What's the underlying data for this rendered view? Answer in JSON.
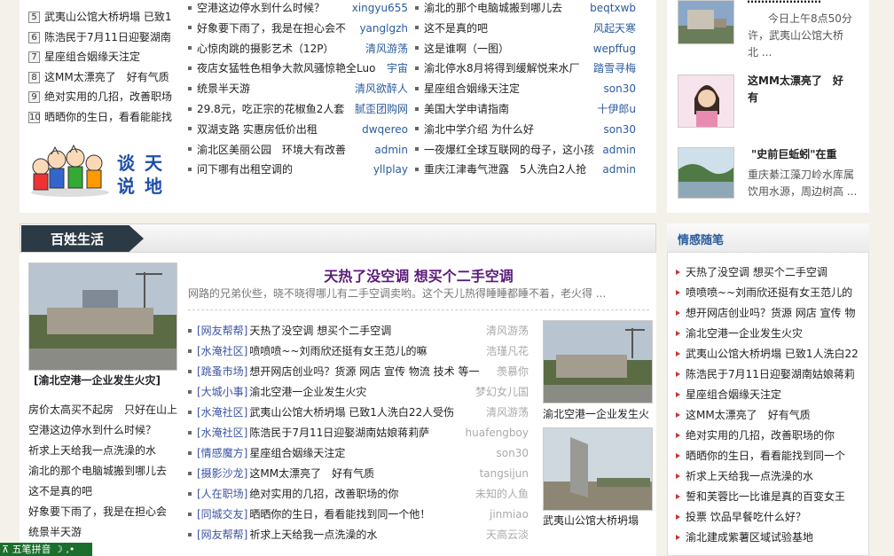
{
  "top_rank": [
    {
      "n": "5",
      "t": "武夷山公馆大桥坍塌 已致1"
    },
    {
      "n": "6",
      "t": "陈浩民于7月11日迎娶湖南"
    },
    {
      "n": "7",
      "t": "星座组合姻缘天注定"
    },
    {
      "n": "8",
      "t": "这MM太漂亮了　好有气质"
    },
    {
      "n": "9",
      "t": "绝对实用的几招，改善职场"
    },
    {
      "n": "10",
      "t": "晒晒你的生日，看看能能找"
    }
  ],
  "tantian": {
    "line1": "谈 天",
    "line2": "说 地"
  },
  "mid_col1": [
    {
      "t": "空港这边停水到什么时候？",
      "u": "xingyu655"
    },
    {
      "t": "好象要下雨了，我是在担心会不",
      "u": "yanglgzh"
    },
    {
      "t": "心惊肉跳的摄影艺术（12P）",
      "u": "清风游荡"
    },
    {
      "t": "夜店女猛牲色相争大款风骚惊艳全Luo",
      "u": "宇宙"
    },
    {
      "t": "统景半天游",
      "u": "清风欲醉人"
    },
    {
      "t": "29.8元，吃正宗的花椒鱼2人套",
      "u": "腻歪团购网"
    },
    {
      "t": "双湖支路 实惠房低价出租",
      "u": "dwqereo"
    },
    {
      "t": "渝北区美丽公园　环境大有改善",
      "u": "admin"
    },
    {
      "t": "问下哪有出租空调的",
      "u": "yllplay"
    }
  ],
  "mid_col2": [
    {
      "t": "渝北的那个电脑城搬到哪儿去",
      "u": "beqtxwb"
    },
    {
      "t": "这不是真的吧",
      "u": "风起天寒"
    },
    {
      "t": "这是谁啊（一图）",
      "u": "wepffug"
    },
    {
      "t": "渝北停水8月将得到缓解悦来水厂",
      "u": "踏雪寻梅"
    },
    {
      "t": "星座组合姻缘天注定",
      "u": "son30"
    },
    {
      "t": "美国大学申请指南",
      "u": "十伊郎u"
    },
    {
      "t": "渝北中学介绍 为什么好",
      "u": "son30"
    },
    {
      "t": "一夜爆红全球互联网的母子，这小孩",
      "u": "admin"
    },
    {
      "t": "重庆江津毒气泄露　5人洗白2人抢",
      "u": "admin"
    }
  ],
  "right_top": {
    "item1_partial": "…………………",
    "item1_desc1": "今日上午8点50分",
    "item1_desc2": "许，武夷山公馆大桥",
    "item1_desc3": "北 ...",
    "item2_title": "这MM太漂亮了　好",
    "item2_title2": "有",
    "item3_title": "\"史前巨蚯蚓\"在重",
    "item3_desc1": "重庆綦江藻刀岭水库属",
    "item3_desc2": "饮用水源，周边树高 ..."
  },
  "baixing": {
    "title": "百姓生活",
    "feature_photo_caption": "[渝北空港一企业发生火灾]",
    "headline": "天热了没空调 想买个二手空调",
    "summary": "网路的兄弟伙些，晓不晓得哪儿有二手空调卖哟。这个天儿热得睡睡都睡不着，老火得 ...",
    "left_list": [
      "房价太高买不起房　只好在山上",
      "空港这边停水到什么时候？",
      "祈求上天给我一点洗澡的水",
      "渝北的那个电脑城搬到哪儿去",
      "这不是真的吧",
      "好象要下雨了，我是在担心会",
      "统景半天游"
    ],
    "list": [
      {
        "c": "[网友帮帮]",
        "t": "天热了没空调 想买个二手空调",
        "u": "清风游荡"
      },
      {
        "c": "[水淹社区]",
        "t": "喷喷喷~~刘雨欣还挺有女王范儿的嘛",
        "u": "浩瑾凡花"
      },
      {
        "c": "[跳蚤市场]",
        "t": "想开网店创业吗？货源 网店 宣传 物流 技术 等一",
        "u": "羡慕你"
      },
      {
        "c": "[大城小事]",
        "t": "渝北空港一企业发生火灾",
        "u": "梦幻女儿国"
      },
      {
        "c": "[水淹社区]",
        "t": "武夷山公馆大桥坍塌 已致1人洗白22人受伤",
        "u": "清风游荡"
      },
      {
        "c": "[水淹社区]",
        "t": "陈浩民于7月11日迎娶湖南姑娘蒋莉萨",
        "u": "huafengboy"
      },
      {
        "c": "[情感魔方]",
        "t": "星座组合姻缘天注定",
        "u": "son30"
      },
      {
        "c": "[摄影沙龙]",
        "t": "这MM太漂亮了　好有气质",
        "u": "tangsijun"
      },
      {
        "c": "[人在职场]",
        "t": "绝对实用的几招，改善职场的你",
        "u": "未知的人鱼"
      },
      {
        "c": "[同城交友]",
        "t": "晒晒你的生日，看看能找到同一个他！",
        "u": "jinmiao"
      },
      {
        "c": "[网友帮帮]",
        "t": "祈求上天给我一点洗澡的水",
        "u": "天高云淡"
      }
    ],
    "photo_caption1": "渝北空港一企业发生火",
    "photo_caption2": "武夷山公馆大桥坍塌"
  },
  "qinggan": {
    "title": "情感随笔",
    "items": [
      "天热了没空调 想买个二手空调",
      "喷喷喷~~刘雨欣还挺有女王范儿的",
      "想开网店创业吗？货源 网店 宣传 物",
      "渝北空港一企业发生火灾",
      "武夷山公馆大桥坍塌 已致1人洗白22",
      "陈浩民于7月11日迎娶湖南姑娘蒋莉",
      "星座组合姻缘天注定",
      "这MM太漂亮了　好有气质",
      "绝对实用的几招，改善职场的你",
      "晒晒你的生日，看看能找到同一个",
      "祈求上天给我一点洗澡的水",
      "誓和芙蓉比一比谁是真的百变女王",
      "投票 饮品早餐吃什么好？",
      "渝北建成紫薯区域试验基地"
    ]
  },
  "ime": {
    "label": "五笔拼音"
  }
}
